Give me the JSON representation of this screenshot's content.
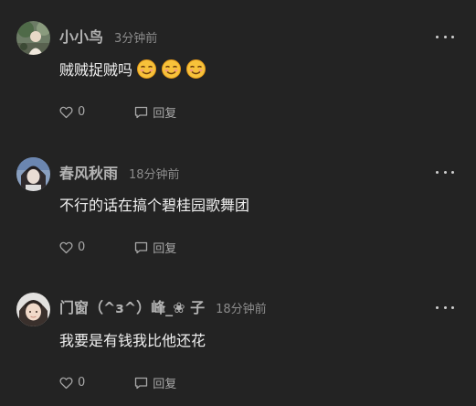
{
  "comments": [
    {
      "name": "小小鸟",
      "time": "3分钟前",
      "text": "贼贼捉贼吗",
      "emoji_count": 3,
      "emoji": "smirk-emoji",
      "likes": "0",
      "reply_label": "回复"
    },
    {
      "name": "春风秋雨",
      "time": "18分钟前",
      "text": "不行的话在搞个碧桂园歌舞团",
      "likes": "0",
      "reply_label": "回复"
    },
    {
      "name": "门窗（^з^）峰_❀ 子",
      "time": "18分钟前",
      "text": "我要是有钱我比他还花",
      "likes": "0",
      "reply_label": "回复"
    }
  ],
  "icons": {
    "like": "heart-outline-icon",
    "reply": "speech-bubble-icon",
    "more": "more-dots-icon"
  },
  "colors": {
    "background": "#232323",
    "name": "#b3b3b3",
    "time": "#8c8c8c",
    "text": "#f0f0f0",
    "action": "#a8a8a8"
  }
}
